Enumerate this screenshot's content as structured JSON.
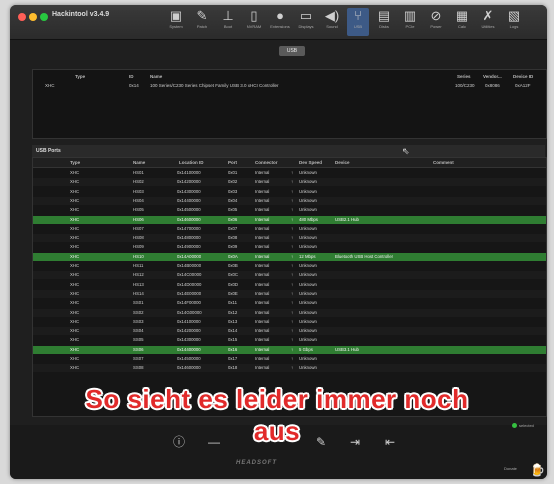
{
  "window": {
    "title": "Hackintool v3.4.9"
  },
  "toolbar": [
    {
      "label": "System",
      "icon": "computer-icon",
      "glyph": "▣"
    },
    {
      "label": "Patch",
      "icon": "brush-icon",
      "glyph": "✎"
    },
    {
      "label": "Boot",
      "icon": "boot-icon",
      "glyph": "⊥"
    },
    {
      "label": "NVRAM",
      "icon": "nvram-icon",
      "glyph": "▯"
    },
    {
      "label": "Extensions",
      "icon": "extensions-icon",
      "glyph": "●"
    },
    {
      "label": "Displays",
      "icon": "display-icon",
      "glyph": "▭"
    },
    {
      "label": "Sound",
      "icon": "speaker-icon",
      "glyph": "◀)"
    },
    {
      "label": "USB",
      "icon": "usb-icon",
      "glyph": "⑂",
      "active": true
    },
    {
      "label": "Disks",
      "icon": "disk-icon",
      "glyph": "▤"
    },
    {
      "label": "PCIe",
      "icon": "pcie-icon",
      "glyph": "▥"
    },
    {
      "label": "Power",
      "icon": "power-icon",
      "glyph": "⊘"
    },
    {
      "label": "Calc",
      "icon": "calculator-icon",
      "glyph": "▦"
    },
    {
      "label": "Utilities",
      "icon": "utilities-icon",
      "glyph": "✗"
    },
    {
      "label": "Logs",
      "icon": "logs-icon",
      "glyph": "▧"
    }
  ],
  "segment_label": "USB",
  "controllers": {
    "headers": {
      "type": "Type",
      "id": "ID",
      "name": "Name",
      "series": "Series",
      "vendor": "Vendor...",
      "device": "Device ID"
    },
    "rows": [
      {
        "type": "XHC",
        "id": "0x14",
        "name": "100 Series/C230 Series Chipset Family USB 3.0 xHCI Controller",
        "series": "100/C230",
        "vendor": "0x8086",
        "device": "0xA12F"
      }
    ]
  },
  "ports_section": "USB Ports",
  "ports": {
    "headers": {
      "type": "Type",
      "name": "Name",
      "location": "Location ID",
      "port": "Port",
      "connector": "Connector",
      "dev_speed": "Dev Speed",
      "device": "Device",
      "comment": "Comment"
    },
    "rows": [
      {
        "type": "XHC",
        "name": "HS01",
        "location": "0x14100000",
        "port": "0x01",
        "connector": "Internal",
        "speed": "Unknown",
        "device": "",
        "hi": false
      },
      {
        "type": "XHC",
        "name": "HS02",
        "location": "0x14200000",
        "port": "0x02",
        "connector": "Internal",
        "speed": "Unknown",
        "device": "",
        "hi": false
      },
      {
        "type": "XHC",
        "name": "HS03",
        "location": "0x14300000",
        "port": "0x03",
        "connector": "Internal",
        "speed": "Unknown",
        "device": "",
        "hi": false
      },
      {
        "type": "XHC",
        "name": "HS04",
        "location": "0x14400000",
        "port": "0x04",
        "connector": "Internal",
        "speed": "Unknown",
        "device": "",
        "hi": false
      },
      {
        "type": "XHC",
        "name": "HS05",
        "location": "0x14500000",
        "port": "0x05",
        "connector": "Internal",
        "speed": "Unknown",
        "device": "",
        "hi": false
      },
      {
        "type": "XHC",
        "name": "HS06",
        "location": "0x14600000",
        "port": "0x06",
        "connector": "Internal",
        "speed": "480 Mbps",
        "device": "USB2.1 Hub",
        "hi": true
      },
      {
        "type": "XHC",
        "name": "HS07",
        "location": "0x14700000",
        "port": "0x07",
        "connector": "Internal",
        "speed": "Unknown",
        "device": "",
        "hi": false
      },
      {
        "type": "XHC",
        "name": "HS08",
        "location": "0x14800000",
        "port": "0x08",
        "connector": "Internal",
        "speed": "Unknown",
        "device": "",
        "hi": false
      },
      {
        "type": "XHC",
        "name": "HS09",
        "location": "0x14900000",
        "port": "0x09",
        "connector": "Internal",
        "speed": "Unknown",
        "device": "",
        "hi": false
      },
      {
        "type": "XHC",
        "name": "HS10",
        "location": "0x14A00000",
        "port": "0x0A",
        "connector": "Internal",
        "speed": "12 Mbps",
        "device": "Bluetooth USB Host Controller",
        "hi": true
      },
      {
        "type": "XHC",
        "name": "HS11",
        "location": "0x14B00000",
        "port": "0x0B",
        "connector": "Internal",
        "speed": "Unknown",
        "device": "",
        "hi": false
      },
      {
        "type": "XHC",
        "name": "HS12",
        "location": "0x14C00000",
        "port": "0x0C",
        "connector": "Internal",
        "speed": "Unknown",
        "device": "",
        "hi": false
      },
      {
        "type": "XHC",
        "name": "HS13",
        "location": "0x14D00000",
        "port": "0x0D",
        "connector": "Internal",
        "speed": "Unknown",
        "device": "",
        "hi": false
      },
      {
        "type": "XHC",
        "name": "HS14",
        "location": "0x14E00000",
        "port": "0x0E",
        "connector": "Internal",
        "speed": "Unknown",
        "device": "",
        "hi": false
      },
      {
        "type": "XHC",
        "name": "SS01",
        "location": "0x14F00000",
        "port": "0x11",
        "connector": "Internal",
        "speed": "Unknown",
        "device": "",
        "hi": false
      },
      {
        "type": "XHC",
        "name": "SS02",
        "location": "0x14G00000",
        "port": "0x12",
        "connector": "Internal",
        "speed": "Unknown",
        "device": "",
        "hi": false
      },
      {
        "type": "XHC",
        "name": "SS03",
        "location": "0x14100000",
        "port": "0x13",
        "connector": "Internal",
        "speed": "Unknown",
        "device": "",
        "hi": false
      },
      {
        "type": "XHC",
        "name": "SS04",
        "location": "0x14200000",
        "port": "0x14",
        "connector": "Internal",
        "speed": "Unknown",
        "device": "",
        "hi": false
      },
      {
        "type": "XHC",
        "name": "SS05",
        "location": "0x14300000",
        "port": "0x15",
        "connector": "Internal",
        "speed": "Unknown",
        "device": "",
        "hi": false
      },
      {
        "type": "XHC",
        "name": "SS06",
        "location": "0x14400000",
        "port": "0x16",
        "connector": "Internal",
        "speed": "5 Gbps",
        "device": "USB3.1 Hub",
        "hi": true
      },
      {
        "type": "XHC",
        "name": "SS07",
        "location": "0x14500000",
        "port": "0x17",
        "connector": "Internal",
        "speed": "Unknown",
        "device": "",
        "hi": false
      },
      {
        "type": "XHC",
        "name": "SS08",
        "location": "0x14600000",
        "port": "0x18",
        "connector": "Internal",
        "speed": "Unknown",
        "device": "",
        "hi": false
      }
    ]
  },
  "overlay": {
    "line1": "So sieht es leider immer noch",
    "line2": "aus"
  },
  "bottom_icons": [
    {
      "icon": "info-icon",
      "glyph": "ⓘ"
    },
    {
      "icon": "minus-icon",
      "glyph": "—"
    },
    {
      "icon": "edit-icon",
      "glyph": "✎"
    },
    {
      "icon": "import-icon",
      "glyph": "⇥"
    },
    {
      "icon": "export-icon",
      "glyph": "⇤"
    }
  ],
  "selected_label": "selected",
  "footer": {
    "brand": "HEADSOFT",
    "donate": "Donate"
  }
}
